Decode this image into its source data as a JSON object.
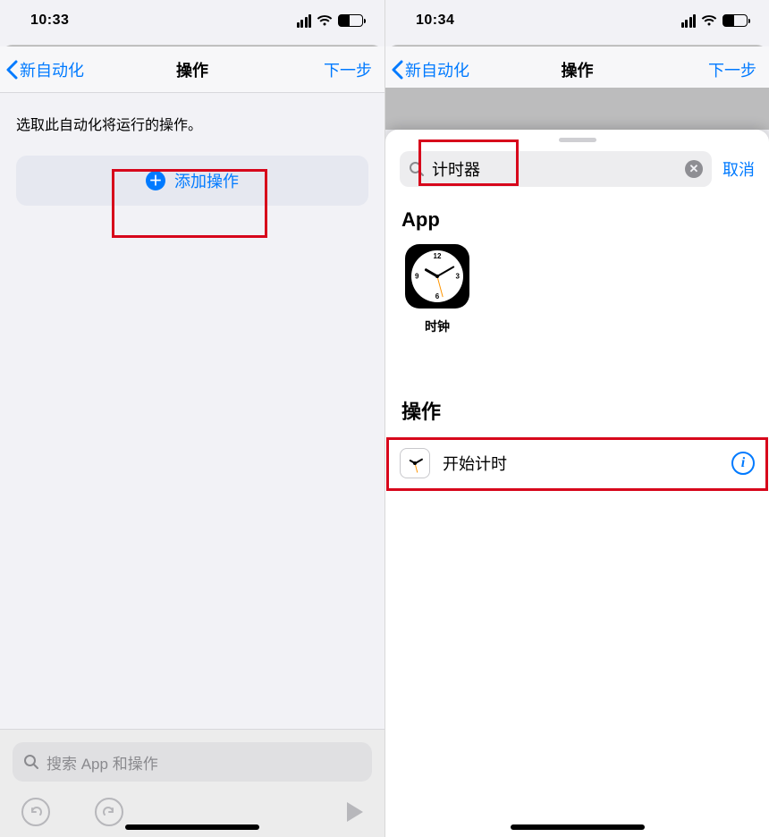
{
  "left": {
    "status_time": "10:33",
    "nav_back": "新自动化",
    "nav_title": "操作",
    "nav_next": "下一步",
    "hint": "选取此自动化将运行的操作。",
    "add_action": "添加操作",
    "search_placeholder": "搜索 App 和操作"
  },
  "right": {
    "status_time": "10:34",
    "nav_back": "新自动化",
    "nav_title": "操作",
    "nav_next": "下一步",
    "search_value": "计时器",
    "cancel": "取消",
    "section_app": "App",
    "app_clock_label": "时钟",
    "section_actions": "操作",
    "action_start_timer": "开始计时"
  }
}
